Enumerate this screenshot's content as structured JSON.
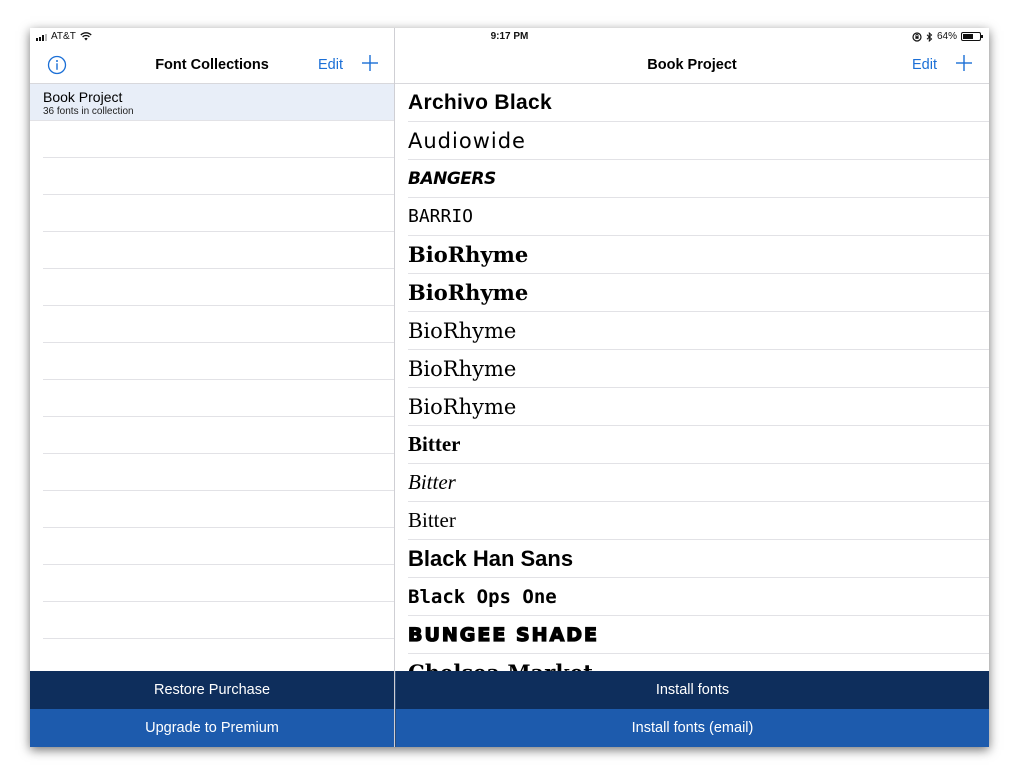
{
  "status_bar": {
    "carrier": "AT&T",
    "time": "9:17 PM",
    "battery": "64%",
    "battery_level": 0.64
  },
  "left_pane": {
    "title": "Font Collections",
    "edit_label": "Edit",
    "collections": [
      {
        "name": "Book Project",
        "subtitle": "36 fonts in collection"
      }
    ],
    "buttons": {
      "restore": "Restore Purchase",
      "upgrade": "Upgrade to Premium"
    }
  },
  "right_pane": {
    "title": "Book Project",
    "edit_label": "Edit",
    "fonts": [
      "Archivo Black",
      "Audiowide",
      "BANGERS",
      "BARRIO",
      "BioRhyme",
      "BioRhyme",
      "BioRhyme",
      "BioRhyme",
      "BioRhyme",
      "Bitter",
      "Bitter",
      "Bitter",
      "Black Han Sans",
      "Black Ops One",
      "BUNGEE SHADE",
      "Chelsea Market"
    ],
    "buttons": {
      "install": "Install fonts",
      "install_email": "Install fonts (email)"
    }
  },
  "colors": {
    "accent": "#1b6fd6",
    "button_dark": "#0e2e5c",
    "button_blue": "#1d5bad",
    "selected_row": "#e8eef8"
  }
}
